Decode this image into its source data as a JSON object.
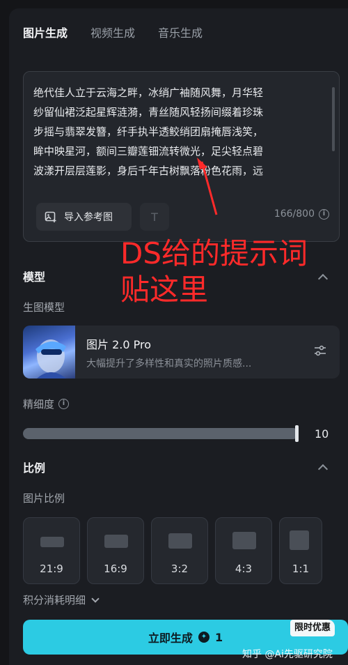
{
  "tabs": [
    {
      "label": "图片生成",
      "active": true
    },
    {
      "label": "视频生成",
      "active": false
    },
    {
      "label": "音乐生成",
      "active": false
    }
  ],
  "prompt": {
    "lines": [
      "绝代佳人立于云海之畔，冰绡广袖随风舞，月华轻",
      "纱留仙裙泛起星辉涟漪，青丝随风轻扬间缀着珍珠",
      "步摇与翡翠发簪，纤手执半透鲛绡团扇掩唇浅笑，",
      "眸中映星河，额间三瓣莲钿流转微光，足尖轻点碧",
      "波漾开层层莲影，身后千年古树飘落粉色花雨，远"
    ],
    "import_ref_label": "导入参考图",
    "text_tool_glyph": "T",
    "counter": "166/800",
    "scroll_fraction": 0.55
  },
  "annotation": {
    "line1": "DS给的提示词",
    "line2": "贴这里",
    "color": "#ff2a2a"
  },
  "model_section": {
    "title": "模型",
    "sub_label": "生图模型",
    "model_name": "图片 2.0 Pro",
    "model_desc": "大幅提升了多样性和真实的照片质感..."
  },
  "detail": {
    "label": "精细度",
    "value": "10",
    "level_fraction": 1.0
  },
  "ratio_section": {
    "title": "比例",
    "sub_label": "图片比例",
    "options": [
      "21:9",
      "16:9",
      "3:2",
      "4:3",
      "1:1"
    ]
  },
  "points_detail_label": "积分消耗明细",
  "generate": {
    "label": "立即生成",
    "cost": "1",
    "promo": "限时优惠"
  },
  "watermark": "知乎 @Ai先驱研究院",
  "colors": {
    "accent": "#2ccbe3",
    "panel": "#1b1d22",
    "annotation": "#ff2a2a"
  }
}
